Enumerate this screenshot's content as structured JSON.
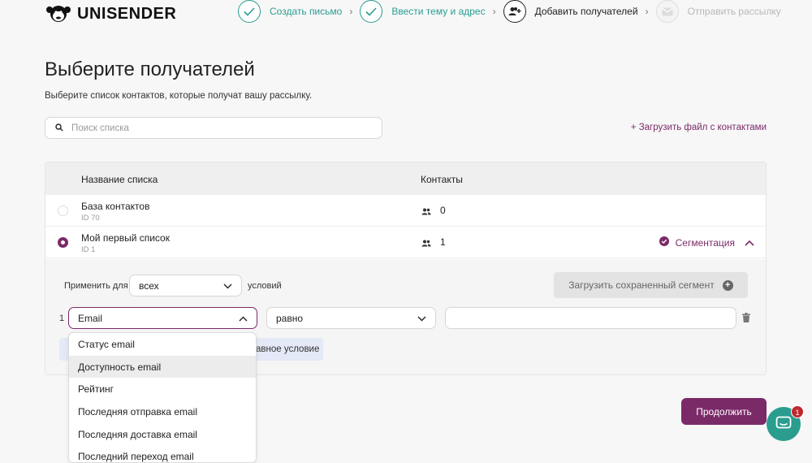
{
  "brand": {
    "name": "UNISENDER",
    "accent": "#7b2a68",
    "step_done_color": "#2a9d8f"
  },
  "steps": [
    {
      "label": "Создать письмо",
      "state": "done",
      "icon": "check-icon"
    },
    {
      "label": "Ввести тему и адрес",
      "state": "done",
      "icon": "check-icon"
    },
    {
      "label": "Добавить получателей",
      "state": "active",
      "icon": "add-users-icon"
    },
    {
      "label": "Отправить рассылку",
      "state": "pending",
      "icon": "envelope-icon"
    }
  ],
  "page": {
    "title": "Выберите получателей",
    "subtitle": "Выберите список контактов, которые получат вашу рассылку."
  },
  "search": {
    "placeholder": "Поиск списка",
    "value": ""
  },
  "upload_link": "+ Загрузить файл с контактами",
  "table": {
    "headers": {
      "name": "Название списка",
      "contacts": "Контакты"
    },
    "rows": [
      {
        "name": "База контактов",
        "id": "ID 70",
        "contacts": "0",
        "selected": false
      },
      {
        "name": "Мой первый список",
        "id": "ID 1",
        "contacts": "1",
        "selected": true,
        "segmentation": "Сегментация"
      }
    ]
  },
  "segment": {
    "apply_label": "Применить для",
    "apply_value": "всех",
    "conditions_label": "условий",
    "load_button": "Загрузить сохраненный сегмент",
    "condition_index": "1",
    "field_value": "Email",
    "operator_value": "равно",
    "value_input": "",
    "add_condition_partial": "авное условие"
  },
  "dropdown_options": [
    {
      "label": "Статус email",
      "hover": false
    },
    {
      "label": "Доступность email",
      "hover": true
    },
    {
      "label": "Рейтинг",
      "hover": false
    },
    {
      "label": "Последняя отправка email",
      "hover": false
    },
    {
      "label": "Последняя доставка email",
      "hover": false
    },
    {
      "label": "Последний переход email",
      "hover": false
    }
  ],
  "continue_button": "Продолжить",
  "chat": {
    "badge": "1"
  }
}
